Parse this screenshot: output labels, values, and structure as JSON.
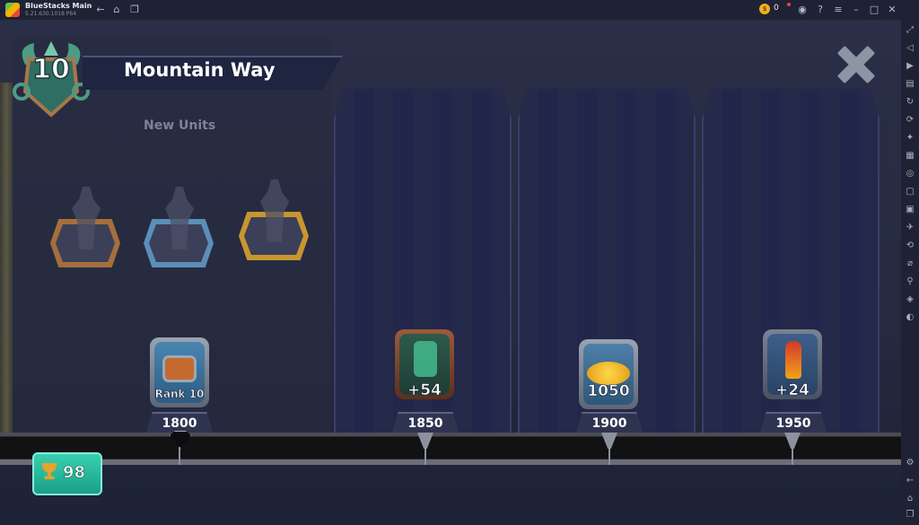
{
  "titlebar": {
    "app_name": "BlueStacks Main",
    "version": "5.21.630.1018 P64",
    "coin_count": "0"
  },
  "game": {
    "level": "10",
    "title": "Mountain Way",
    "new_units_label": "New Units",
    "rewards": [
      {
        "label": "Rank 10",
        "cost": "1800",
        "icon": "chest-icon"
      },
      {
        "label": "+54",
        "cost": "1850",
        "icon": "zombie-unit-icon"
      },
      {
        "label": "1050",
        "cost": "1900",
        "icon": "gold-pile-icon"
      },
      {
        "label": "+24",
        "cost": "1950",
        "icon": "fire-unit-icon"
      }
    ],
    "trophies": "98"
  },
  "colors": {
    "background": "#252a40",
    "trophy_badge": "#1c9f88",
    "coin": "#f2b01e"
  }
}
